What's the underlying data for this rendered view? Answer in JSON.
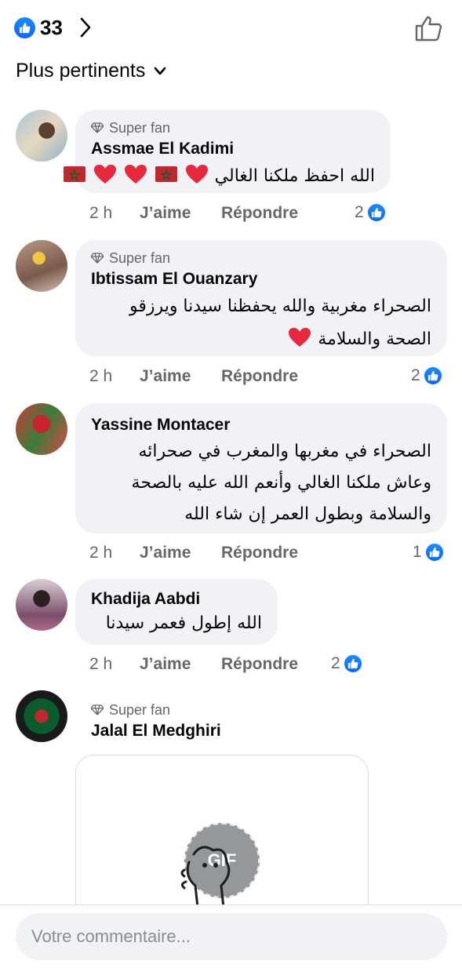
{
  "header": {
    "reaction_count": "33",
    "reaction_icon": "like-icon",
    "colors": {
      "like_blue": "#0866ff",
      "bubble_bg": "#f0f2f5",
      "secondary_text": "#65676b"
    }
  },
  "sort": {
    "label": "Plus pertinents"
  },
  "comments": [
    {
      "badge": "Super fan",
      "author": "Assmae El Kadimi",
      "text": "الله احفظ ملكنا الغالي",
      "time": "2 h",
      "like_label": "J’aime",
      "reply_label": "Répondre",
      "reactions": "2"
    },
    {
      "badge": "Super fan",
      "author": "Ibtissam El Ouanzary",
      "text_lines": [
        "الصحراء مغربية  والله يحفظنا سيدنا ويرزقو",
        "الصحة والسلامة"
      ],
      "time": "2 h",
      "like_label": "J’aime",
      "reply_label": "Répondre",
      "reactions": "2"
    },
    {
      "author": "Yassine Montacer",
      "text_lines": [
        "الصحراء في مغربها والمغرب في صحرائه",
        "وعاش ملكنا الغالي وأنعم الله عليه بالصحة",
        "والسلامة وبطول العمر إن شاء الله"
      ],
      "time": "2 h",
      "like_label": "J’aime",
      "reply_label": "Répondre",
      "reactions": "1"
    },
    {
      "author": "Khadija Aabdi",
      "text": "الله إطول فعمر سيدنا",
      "time": "2 h",
      "like_label": "J’aime",
      "reply_label": "Répondre",
      "reactions": "2"
    },
    {
      "badge": "Super fan",
      "author": "Jalal El Medghiri",
      "gif_label": "GIF"
    }
  ],
  "composer": {
    "placeholder": "Votre commentaire..."
  }
}
